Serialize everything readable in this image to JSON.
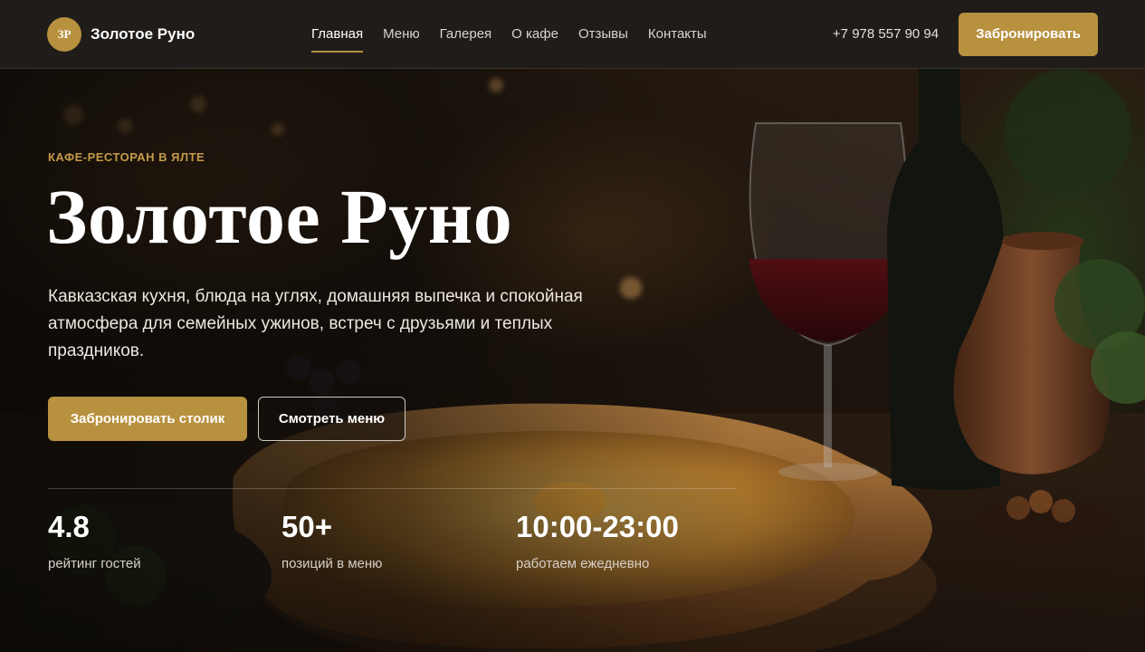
{
  "header": {
    "logo_initials": "ЗР",
    "brand_name": "Золотое Руно",
    "nav": [
      {
        "label": "Главная",
        "active": true
      },
      {
        "label": "Меню",
        "active": false
      },
      {
        "label": "Галерея",
        "active": false
      },
      {
        "label": "О кафе",
        "active": false
      },
      {
        "label": "Отзывы",
        "active": false
      },
      {
        "label": "Контакты",
        "active": false
      }
    ],
    "phone": "+7 978 557 90 94",
    "book_button": "Забронировать"
  },
  "hero": {
    "eyebrow": "КАФЕ-РЕСТОРАН В ЯЛТЕ",
    "title": "Золотое Руно",
    "description": "Кавказская кухня, блюда на углях, домашняя выпечка и спокойная атмосфера для семейных ужинов, встреч с друзьями и теплых праздников.",
    "primary_button": "Забронировать столик",
    "secondary_button": "Смотреть меню"
  },
  "stats": [
    {
      "value": "4.8",
      "label": "рейтинг гостей"
    },
    {
      "value": "50+",
      "label": "позиций в меню"
    },
    {
      "value": "10:00-23:00",
      "label": "работаем ежедневно"
    }
  ],
  "colors": {
    "accent": "#b8913f",
    "header_bg": "#1f1c19"
  }
}
